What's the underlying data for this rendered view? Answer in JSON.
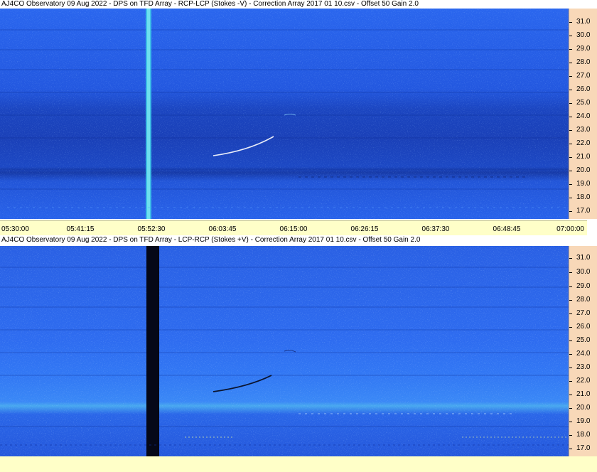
{
  "panels": [
    {
      "title": "AJ4CO Observatory 09 Aug 2022  -  DPS on TFD Array  -  RCP-LCP (Stokes -V)  -  Correction Array 2017 01 10.csv  -  Offset 50  Gain 2.0"
    },
    {
      "title": "AJ4CO Observatory 09 Aug 2022  -  DPS on TFD Array  -  LCP-RCP (Stokes +V)  -  Correction Array 2017 01 10.csv  -  Offset 50  Gain 2.0"
    }
  ],
  "y_axis_labels": [
    "31.0",
    "30.0",
    "29.0",
    "28.0",
    "27.0",
    "26.0",
    "25.0",
    "24.0",
    "23.0",
    "22.0",
    "21.0",
    "20.0",
    "19.0",
    "18.0",
    "17.0"
  ],
  "time_axis_labels": [
    "05:30:00",
    "05:41:15",
    "05:52:30",
    "06:03:45",
    "06:15:00",
    "06:26:15",
    "06:37:30",
    "06:48:45",
    "07:00:00"
  ],
  "colors": {
    "spectrogram_base": "#1f55e6",
    "axis_panel": "#f8d8b8",
    "time_strip": "#ffffc8"
  }
}
